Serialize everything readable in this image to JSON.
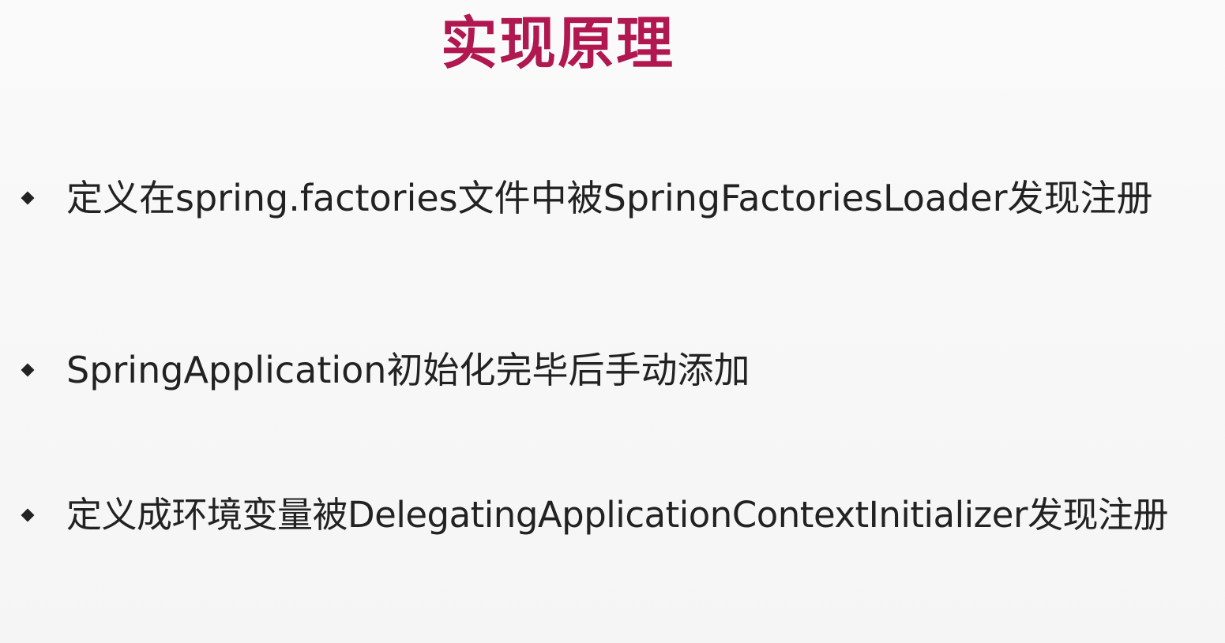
{
  "slide": {
    "title": "实现原理",
    "bullets": [
      "定义在spring.factories文件中被SpringFactoriesLoader发现注册",
      "SpringApplication初始化完毕后手动添加",
      "定义成环境变量被DelegatingApplicationContextInitializer发现注册"
    ],
    "colors": {
      "title": "#b0184f",
      "text": "#222222",
      "background": "#f7f7f7"
    },
    "icon": "diamond-bullet-icon"
  }
}
